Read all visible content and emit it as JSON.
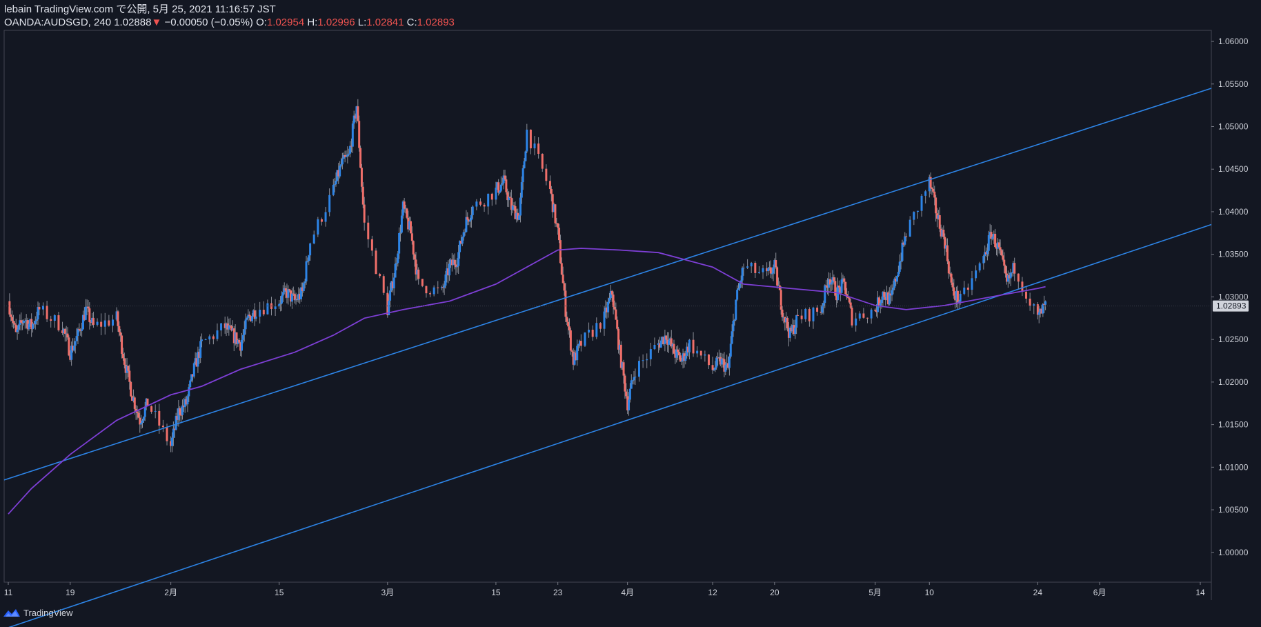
{
  "header": {
    "publisher_line": "lebain TradingView.com で公開, 5月 25, 2021 11:16:57 JST",
    "symbol": "OANDA:AUDSGD, 240",
    "last": "1.02888",
    "change": "−0.00050 (−0.05%)",
    "o_label": "O:",
    "o_value": "1.02954",
    "h_label": "H:",
    "h_value": "1.02996",
    "l_label": "L:",
    "l_value": "1.02841",
    "c_label": "C:",
    "c_value": "1.02893"
  },
  "footer": {
    "brand": "TradingView",
    "logo_icon": "tradingview-logo-icon"
  },
  "colors": {
    "background": "#131722",
    "up": "#2d84e6",
    "down": "#ef6f6a",
    "wick": "#8c8f99",
    "ma": "#7e3fd6",
    "channel": "#2d84e6",
    "price_badge": "#d1d4dc"
  },
  "chart_data": {
    "type": "candlestick",
    "title": "OANDA:AUDSGD, 240",
    "ylim": [
      0.9965,
      1.0613
    ],
    "y_ticks": [
      1.0,
      1.005,
      1.01,
      1.015,
      1.02,
      1.025,
      1.03,
      1.035,
      1.04,
      1.045,
      1.05,
      1.055,
      1.06
    ],
    "y_tick_labels": [
      "1.00000",
      "1.00500",
      "1.01000",
      "1.01500",
      "1.02000",
      "1.02500",
      "1.03000",
      "1.03500",
      "1.04000",
      "1.04500",
      "1.05000",
      "1.05500",
      "1.06000"
    ],
    "x_ticks": [
      {
        "label": "11",
        "date": "2021-01-11"
      },
      {
        "label": "19",
        "date": "2021-01-19"
      },
      {
        "label": "2月",
        "date": "2021-02-01"
      },
      {
        "label": "15",
        "date": "2021-02-15"
      },
      {
        "label": "3月",
        "date": "2021-03-01"
      },
      {
        "label": "15",
        "date": "2021-03-15"
      },
      {
        "label": "23",
        "date": "2021-03-23"
      },
      {
        "label": "4月",
        "date": "2021-04-01"
      },
      {
        "label": "12",
        "date": "2021-04-12"
      },
      {
        "label": "20",
        "date": "2021-04-20"
      },
      {
        "label": "5月",
        "date": "2021-05-03"
      },
      {
        "label": "10",
        "date": "2021-05-10"
      },
      {
        "label": "24",
        "date": "2021-05-24"
      },
      {
        "label": "6月",
        "date": "2021-06-01"
      },
      {
        "label": "14",
        "date": "2021-06-14"
      }
    ],
    "last_price": 1.02893,
    "last_price_label": "1.02893",
    "close_path": [
      [
        "2021-01-11",
        1.0295
      ],
      [
        "2021-01-12",
        1.0255
      ],
      [
        "2021-01-13",
        1.0275
      ],
      [
        "2021-01-14",
        1.0265
      ],
      [
        "2021-01-15",
        1.0285
      ],
      [
        "2021-01-18",
        1.0265
      ],
      [
        "2021-01-19",
        1.0235
      ],
      [
        "2021-01-20",
        1.0255
      ],
      [
        "2021-01-21",
        1.0285
      ],
      [
        "2021-01-22",
        1.0265
      ],
      [
        "2021-01-25",
        1.0275
      ],
      [
        "2021-01-26",
        1.0225
      ],
      [
        "2021-01-27",
        1.0185
      ],
      [
        "2021-01-28",
        1.0155
      ],
      [
        "2021-01-29",
        1.0175
      ],
      [
        "2021-02-01",
        1.0125
      ],
      [
        "2021-02-02",
        1.0165
      ],
      [
        "2021-02-03",
        1.0175
      ],
      [
        "2021-02-04",
        1.0215
      ],
      [
        "2021-02-05",
        1.0245
      ],
      [
        "2021-02-08",
        1.0265
      ],
      [
        "2021-02-09",
        1.0255
      ],
      [
        "2021-02-10",
        1.0245
      ],
      [
        "2021-02-11",
        1.0275
      ],
      [
        "2021-02-12",
        1.0285
      ],
      [
        "2021-02-15",
        1.0295
      ],
      [
        "2021-02-16",
        1.0305
      ],
      [
        "2021-02-17",
        1.0295
      ],
      [
        "2021-02-18",
        1.0305
      ],
      [
        "2021-02-19",
        1.0365
      ],
      [
        "2021-02-22",
        1.0425
      ],
      [
        "2021-02-23",
        1.0455
      ],
      [
        "2021-02-24",
        1.0465
      ],
      [
        "2021-02-25",
        1.0525
      ],
      [
        "2021-02-26",
        1.0385
      ],
      [
        "2021-03-01",
        1.0285
      ],
      [
        "2021-03-02",
        1.0335
      ],
      [
        "2021-03-03",
        1.0405
      ],
      [
        "2021-03-04",
        1.0375
      ],
      [
        "2021-03-05",
        1.0315
      ],
      [
        "2021-03-08",
        1.0305
      ],
      [
        "2021-03-09",
        1.0335
      ],
      [
        "2021-03-10",
        1.0345
      ],
      [
        "2021-03-11",
        1.0385
      ],
      [
        "2021-03-12",
        1.0405
      ],
      [
        "2021-03-15",
        1.0425
      ],
      [
        "2021-03-16",
        1.0435
      ],
      [
        "2021-03-17",
        1.0405
      ],
      [
        "2021-03-18",
        1.0395
      ],
      [
        "2021-03-19",
        1.0495
      ],
      [
        "2021-03-22",
        1.0425
      ],
      [
        "2021-03-23",
        1.0375
      ],
      [
        "2021-03-24",
        1.0285
      ],
      [
        "2021-03-25",
        1.0225
      ],
      [
        "2021-03-26",
        1.0245
      ],
      [
        "2021-03-29",
        1.0275
      ],
      [
        "2021-03-30",
        1.0305
      ],
      [
        "2021-03-31",
        1.0235
      ],
      [
        "2021-04-01",
        1.0175
      ],
      [
        "2021-04-02",
        1.0215
      ],
      [
        "2021-04-05",
        1.0245
      ],
      [
        "2021-04-06",
        1.0255
      ],
      [
        "2021-04-07",
        1.0235
      ],
      [
        "2021-04-08",
        1.0225
      ],
      [
        "2021-04-09",
        1.0245
      ],
      [
        "2021-04-12",
        1.0215
      ],
      [
        "2021-04-13",
        1.0225
      ],
      [
        "2021-04-14",
        1.0215
      ],
      [
        "2021-04-15",
        1.0295
      ],
      [
        "2021-04-16",
        1.0335
      ],
      [
        "2021-04-19",
        1.0325
      ],
      [
        "2021-04-20",
        1.0335
      ],
      [
        "2021-04-21",
        1.0285
      ],
      [
        "2021-04-22",
        1.0255
      ],
      [
        "2021-04-23",
        1.0275
      ],
      [
        "2021-04-26",
        1.0285
      ],
      [
        "2021-04-27",
        1.0325
      ],
      [
        "2021-04-28",
        1.0305
      ],
      [
        "2021-04-29",
        1.0315
      ],
      [
        "2021-04-30",
        1.0275
      ],
      [
        "2021-05-03",
        1.0285
      ],
      [
        "2021-05-04",
        1.0305
      ],
      [
        "2021-05-05",
        1.0295
      ],
      [
        "2021-05-06",
        1.0335
      ],
      [
        "2021-05-07",
        1.0375
      ],
      [
        "2021-05-10",
        1.0435
      ],
      [
        "2021-05-11",
        1.0395
      ],
      [
        "2021-05-12",
        1.0365
      ],
      [
        "2021-05-13",
        1.0305
      ],
      [
        "2021-05-14",
        1.0295
      ],
      [
        "2021-05-17",
        1.0345
      ],
      [
        "2021-05-18",
        1.0375
      ],
      [
        "2021-05-19",
        1.0355
      ],
      [
        "2021-05-20",
        1.0315
      ],
      [
        "2021-05-21",
        1.0335
      ],
      [
        "2021-05-24",
        1.0275
      ],
      [
        "2021-05-25",
        1.02893
      ]
    ],
    "moving_average": [
      [
        "2021-01-11",
        1.0045
      ],
      [
        "2021-01-14",
        1.0075
      ],
      [
        "2021-01-19",
        1.0115
      ],
      [
        "2021-01-25",
        1.0155
      ],
      [
        "2021-02-01",
        1.0185
      ],
      [
        "2021-02-05",
        1.0195
      ],
      [
        "2021-02-10",
        1.0215
      ],
      [
        "2021-02-17",
        1.0235
      ],
      [
        "2021-02-22",
        1.0255
      ],
      [
        "2021-02-26",
        1.0275
      ],
      [
        "2021-03-03",
        1.0285
      ],
      [
        "2021-03-09",
        1.0295
      ],
      [
        "2021-03-15",
        1.0315
      ],
      [
        "2021-03-19",
        1.0335
      ],
      [
        "2021-03-23",
        1.0355
      ],
      [
        "2021-03-26",
        1.0357
      ],
      [
        "2021-03-31",
        1.0355
      ],
      [
        "2021-04-05",
        1.0352
      ],
      [
        "2021-04-12",
        1.0335
      ],
      [
        "2021-04-16",
        1.0315
      ],
      [
        "2021-04-22",
        1.031
      ],
      [
        "2021-04-28",
        1.0305
      ],
      [
        "2021-05-03",
        1.029
      ],
      [
        "2021-05-07",
        1.0285
      ],
      [
        "2021-05-12",
        1.029
      ],
      [
        "2021-05-18",
        1.03
      ],
      [
        "2021-05-24",
        1.031
      ],
      [
        "2021-05-25",
        1.0312
      ]
    ],
    "channel_lines": [
      {
        "x": [
          "2021-01-11",
          "2021-06-14"
        ],
        "y": [
          1.0085,
          1.0545
        ]
      },
      {
        "x": [
          "2021-01-11",
          "2021-06-14"
        ],
        "y": [
          0.991,
          1.0385
        ]
      }
    ]
  }
}
